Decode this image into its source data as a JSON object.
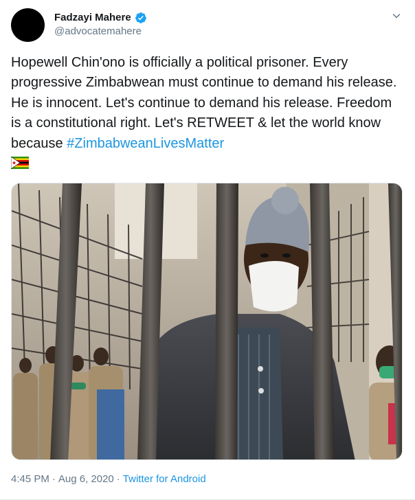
{
  "user": {
    "display_name": "Fadzayi Mahere",
    "handle": "@advocatemahere",
    "verified": true
  },
  "tweet": {
    "text_before_hashtag": "Hopewell Chin'ono is officially a political prisoner. Every progressive Zimbabwean must continue to demand his release. He is innocent. Let's continue to demand his release. Freedom is a constitutional right. Let's RETWEET & let the world know because ",
    "hashtag": "#ZimbabweanLivesMatter",
    "emoji": "flag-zimbabwe-icon"
  },
  "meta": {
    "time": "4:45 PM",
    "separator_1": "·",
    "date": "Aug 6, 2020",
    "separator_2": "·",
    "source": "Twitter for Android"
  },
  "icons": {
    "verified": "verified-badge-icon",
    "more": "chevron-down-icon"
  },
  "colors": {
    "link": "#1b95e0",
    "secondary_text": "#657786",
    "primary_text": "#14171a",
    "verified_badge": "#1da1f2"
  }
}
